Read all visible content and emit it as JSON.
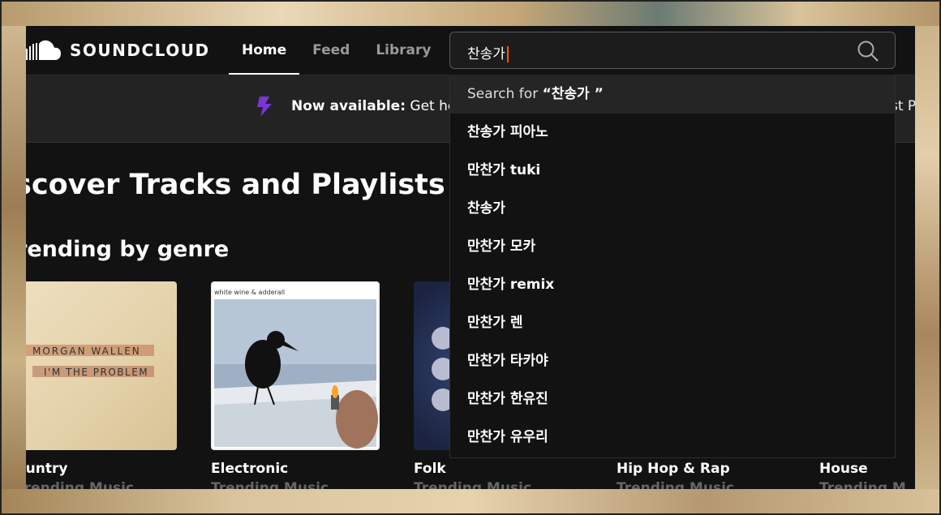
{
  "app": {
    "brand": "SOUNDCLOUD",
    "nav": [
      {
        "label": "Home"
      },
      {
        "label": "Feed"
      },
      {
        "label": "Library"
      }
    ]
  },
  "search": {
    "value": "찬송가",
    "icon": "search-icon"
  },
  "banner": {
    "icon": "lightning-bolt-icon",
    "bold": "Now available:",
    "text": " Get he",
    "right_text": "st P",
    "accent": "#7b35d6"
  },
  "main": {
    "title": "scover Tracks and Playlists",
    "section_title": "rending by genre",
    "genres": [
      {
        "name": "ountry",
        "sub": "Trending Music",
        "album_text": [
          "MORGAN WALLEN",
          "I'M THE PROBLEM"
        ]
      },
      {
        "name": "Electronic",
        "sub": "Trending Music",
        "album_caption": "white wine & adderall"
      },
      {
        "name": "Folk",
        "sub": "Trending Music"
      },
      {
        "name": "Hip Hop & Rap",
        "sub": "Trending Music"
      },
      {
        "name": "House",
        "sub": "Trending M"
      }
    ]
  },
  "dropdown": {
    "search_for_prefix": "Search for ",
    "search_for_query": "“찬송가 ”",
    "suggestions": [
      "찬송가 피아노",
      "만찬가 tuki",
      "찬송가",
      "만찬가 모카",
      "만찬가 remix",
      "만찬가 렌",
      "만찬가 타카야",
      "만찬가 한유진",
      "만찬가 유우리"
    ]
  }
}
